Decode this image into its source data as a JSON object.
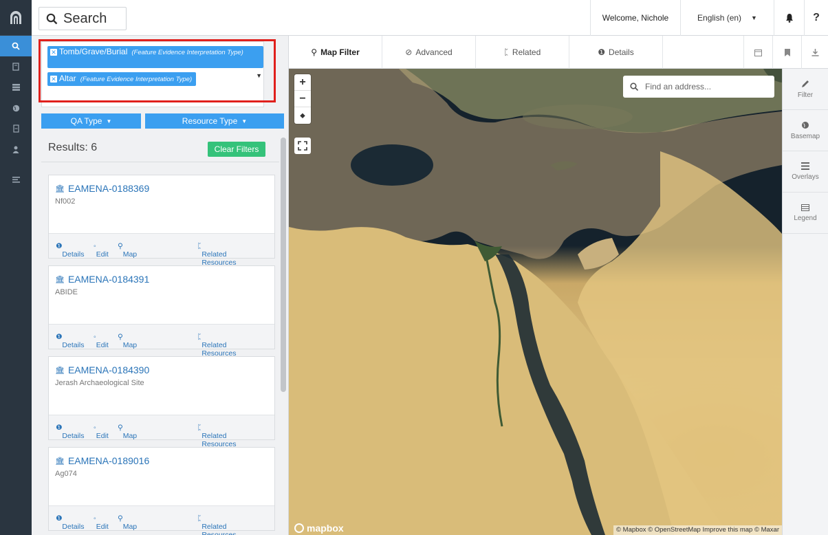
{
  "rail": {
    "items": [
      {
        "icon": "search-icon",
        "active": true
      },
      {
        "icon": "book-icon",
        "active": false
      },
      {
        "icon": "grid-icon",
        "active": false
      },
      {
        "icon": "globe-icon",
        "active": false
      },
      {
        "icon": "document-icon",
        "active": false
      },
      {
        "icon": "user-icon",
        "active": false
      },
      {
        "icon": "list-icon",
        "active": false
      }
    ]
  },
  "header": {
    "search_label": "Search",
    "welcome": "Welcome, Nichole",
    "language": "English (en)"
  },
  "filters": {
    "chips": [
      {
        "label": "Tomb/Grave/Burial",
        "type": "(Feature Evidence Interpretation Type)"
      },
      {
        "label": "Altar",
        "type": "(Feature Evidence Interpretation Type)"
      }
    ],
    "dropdowns": {
      "qa_type": "QA Type",
      "resource_type": "Resource Type"
    }
  },
  "results": {
    "count_label": "Results: 6",
    "clear_label": "Clear Filters",
    "cards": [
      {
        "id": "EAMENA-0188369",
        "name": "Nf002"
      },
      {
        "id": "EAMENA-0184391",
        "name": "ABIDE"
      },
      {
        "id": "EAMENA-0184390",
        "name": "Jerash Archaeological Site"
      },
      {
        "id": "EAMENA-0189016",
        "name": "Ag074"
      }
    ],
    "card_actions": {
      "details": "Details",
      "edit": "Edit",
      "map": "Map",
      "related": "Related Resources"
    }
  },
  "tabs": {
    "map_filter": "Map Filter",
    "advanced": "Advanced",
    "related": "Related",
    "details": "Details"
  },
  "map": {
    "geocoder_placeholder": "Find an address...",
    "logo": "mapbox",
    "attribution": "© Mapbox © OpenStreetMap Improve this map © Maxar"
  },
  "tools": {
    "filter": "Filter",
    "basemap": "Basemap",
    "overlays": "Overlays",
    "legend": "Legend"
  },
  "colors": {
    "accent": "#3b9ff0",
    "rail": "#2a3540",
    "clear_button": "#35c27a",
    "highlight_box": "#e0201c"
  }
}
